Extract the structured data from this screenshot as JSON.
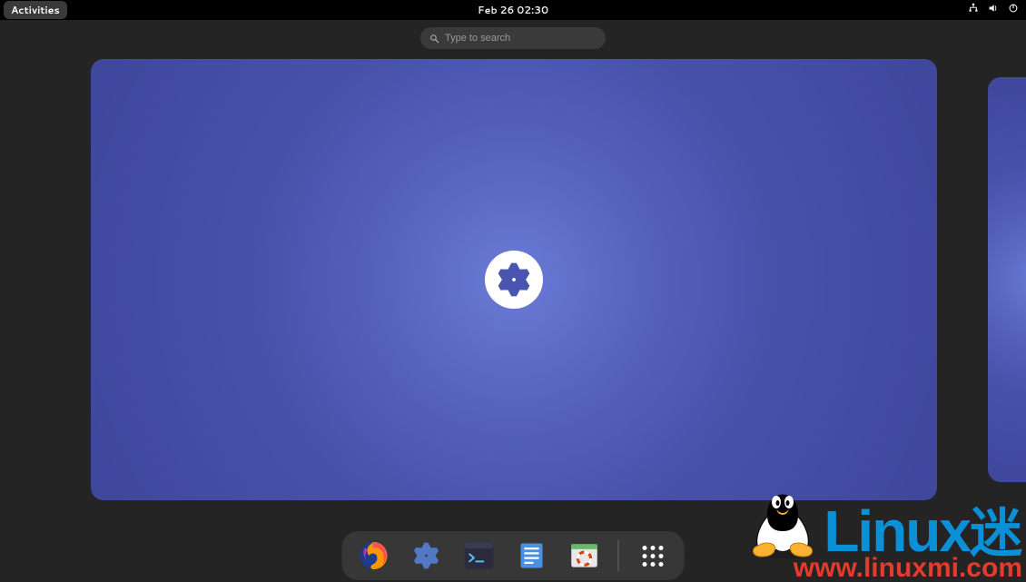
{
  "topbar": {
    "activities": "Activities",
    "clock": "Feb 26  02:30"
  },
  "search": {
    "placeholder": "Type to search"
  },
  "dock": {
    "items": [
      {
        "name": "firefox"
      },
      {
        "name": "nixos-manual"
      },
      {
        "name": "terminal"
      },
      {
        "name": "files"
      },
      {
        "name": "help"
      },
      {
        "name": "show-apps"
      }
    ]
  },
  "watermark": {
    "brand_latin": "Linux",
    "brand_cjk": "迷",
    "url": "www.linuxmi.com"
  },
  "colors": {
    "accent": "#4a55b0",
    "watermark_blue": "#0b8fd6",
    "watermark_red": "#e43b2e"
  }
}
